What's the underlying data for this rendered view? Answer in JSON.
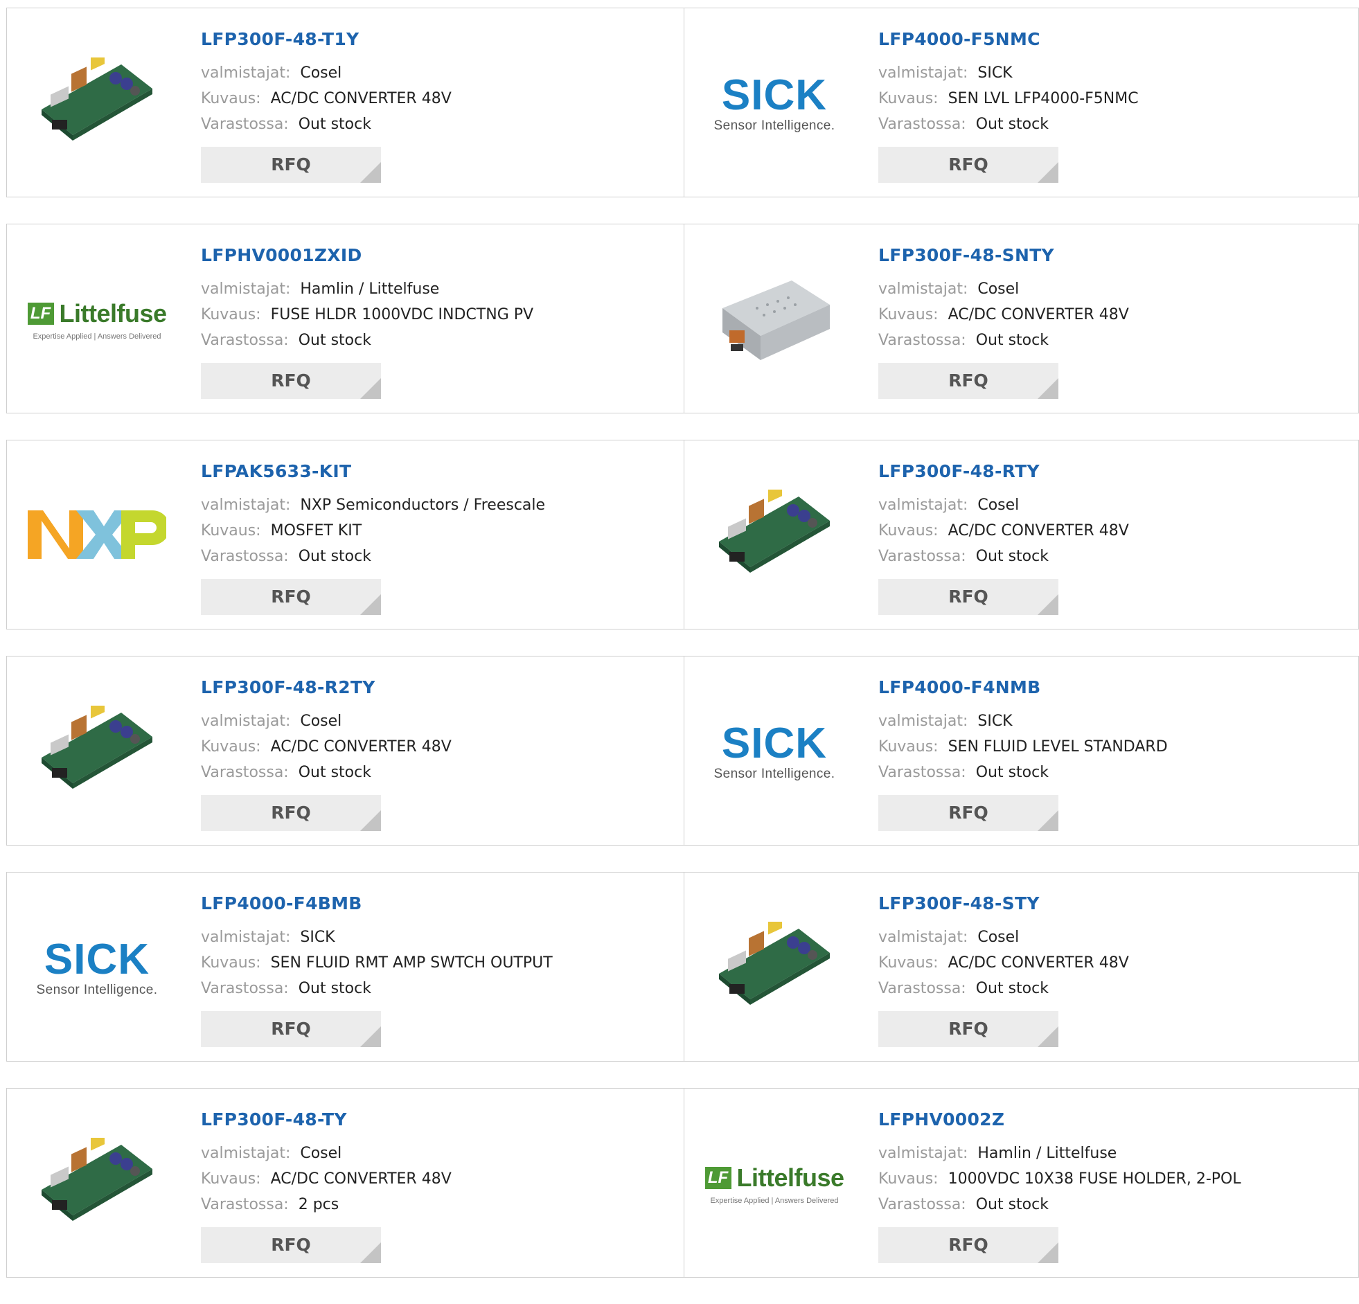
{
  "labels": {
    "manufacturer": "valmistajat:",
    "description": "Kuvaus:",
    "stock": "Varastossa:",
    "rfq": "RFQ"
  },
  "logos": {
    "sick": {
      "name": "SICK",
      "tagline": "Sensor Intelligence."
    },
    "littelfuse": {
      "name": "Littelfuse",
      "mark": "LF",
      "tagline": "Expertise Applied | Answers Delivered"
    }
  },
  "products": [
    {
      "pn": "LFP300F-48-T1Y",
      "manufacturer": "Cosel",
      "description": "AC/DC CONVERTER 48V",
      "stock": "Out stock",
      "image": "power-supply-board"
    },
    {
      "pn": "LFP4000-F5NMC",
      "manufacturer": "SICK",
      "description": "SEN LVL LFP4000-F5NMC",
      "stock": "Out stock",
      "image": "sick-logo"
    },
    {
      "pn": "LFPHV0001ZXID",
      "manufacturer": "Hamlin / Littelfuse",
      "description": "FUSE HLDR 1000VDC INDCTNG PV",
      "stock": "Out stock",
      "image": "littelfuse-logo"
    },
    {
      "pn": "LFP300F-48-SNTY",
      "manufacturer": "Cosel",
      "description": "AC/DC CONVERTER 48V",
      "stock": "Out stock",
      "image": "enclosed-power-supply"
    },
    {
      "pn": "LFPAK5633-KIT",
      "manufacturer": "NXP Semiconductors / Freescale",
      "description": "MOSFET KIT",
      "stock": "Out stock",
      "image": "nxp-logo"
    },
    {
      "pn": "LFP300F-48-RTY",
      "manufacturer": "Cosel",
      "description": "AC/DC CONVERTER 48V",
      "stock": "Out stock",
      "image": "power-supply-board"
    },
    {
      "pn": "LFP300F-48-R2TY",
      "manufacturer": "Cosel",
      "description": "AC/DC CONVERTER 48V",
      "stock": "Out stock",
      "image": "power-supply-board"
    },
    {
      "pn": "LFP4000-F4NMB",
      "manufacturer": "SICK",
      "description": "SEN FLUID LEVEL STANDARD",
      "stock": "Out stock",
      "image": "sick-logo"
    },
    {
      "pn": "LFP4000-F4BMB",
      "manufacturer": "SICK",
      "description": "SEN FLUID RMT AMP SWTCH OUTPUT",
      "stock": "Out stock",
      "image": "sick-logo"
    },
    {
      "pn": "LFP300F-48-STY",
      "manufacturer": "Cosel",
      "description": "AC/DC CONVERTER 48V",
      "stock": "Out stock",
      "image": "power-supply-board"
    },
    {
      "pn": "LFP300F-48-TY",
      "manufacturer": "Cosel",
      "description": "AC/DC CONVERTER 48V",
      "stock": "2 pcs",
      "image": "power-supply-board"
    },
    {
      "pn": "LFPHV0002Z",
      "manufacturer": "Hamlin / Littelfuse",
      "description": "1000VDC 10X38 FUSE HOLDER, 2-POL",
      "stock": "Out stock",
      "image": "littelfuse-logo"
    }
  ],
  "colors": {
    "link": "#1d63ad",
    "label": "#9a9a9a",
    "button_bg": "#ececec",
    "sick_blue": "#1b80c4",
    "littelfuse_green": "#4e9a35",
    "nxp_orange": "#f5a524",
    "nxp_blue": "#7fc2dc",
    "nxp_green": "#c4d72e"
  }
}
